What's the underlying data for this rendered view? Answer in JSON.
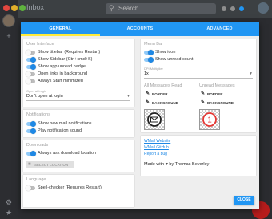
{
  "window": {
    "title": "Inbox"
  },
  "search": {
    "placeholder": "Search"
  },
  "tabs": [
    {
      "label": "GENERAL"
    },
    {
      "label": "ACCOUNTS"
    },
    {
      "label": "ADVANCED"
    }
  ],
  "user_interface": {
    "title": "User Interface",
    "items": [
      {
        "label": "Show titlebar (Requires Restart)",
        "on": false
      },
      {
        "label": "Show Sidebar (Ctrl+cmd+S)",
        "on": true
      },
      {
        "label": "Show app unread badge",
        "on": true
      },
      {
        "label": "Open links in background",
        "on": false
      },
      {
        "label": "Always Start minimized",
        "on": false
      }
    ],
    "open_at_login_label": "Open at Login",
    "open_at_login_value": "Don't open at login"
  },
  "notifications": {
    "title": "Notifications",
    "items": [
      {
        "label": "Show new mail notifications",
        "on": true
      },
      {
        "label": "Play notification sound",
        "on": true
      }
    ]
  },
  "downloads": {
    "title": "Downloads",
    "items": [
      {
        "label": "Always ask download location",
        "on": true
      }
    ],
    "select_location": "SELECT LOCATION"
  },
  "language": {
    "title": "Language",
    "items": [
      {
        "label": "Spell-checker (Requires Restart)",
        "on": false
      }
    ]
  },
  "menu_bar": {
    "title": "Menu Bar",
    "items": [
      {
        "label": "Show icon",
        "on": true
      },
      {
        "label": "Show unread count",
        "on": true
      }
    ],
    "dpi_label": "DPI Multiplier",
    "dpi_value": "1x",
    "all_read_title": "All Messages Read",
    "unread_title": "Unread Messages",
    "border_label": "BORDER",
    "background_label": "BACKGROUND",
    "unread_count": "1"
  },
  "links": {
    "website": "WMail Website",
    "github": "WMail GitHub",
    "report": "Report a bug",
    "made_with": "Made with ♥ by Thomas Beverley"
  },
  "footer": {
    "close": "CLOSE"
  },
  "colors": {
    "primary": "#2196f3",
    "accent": "#ffeb3b",
    "toggle_on": "#1e88e5",
    "badge_red": "#e53935"
  }
}
